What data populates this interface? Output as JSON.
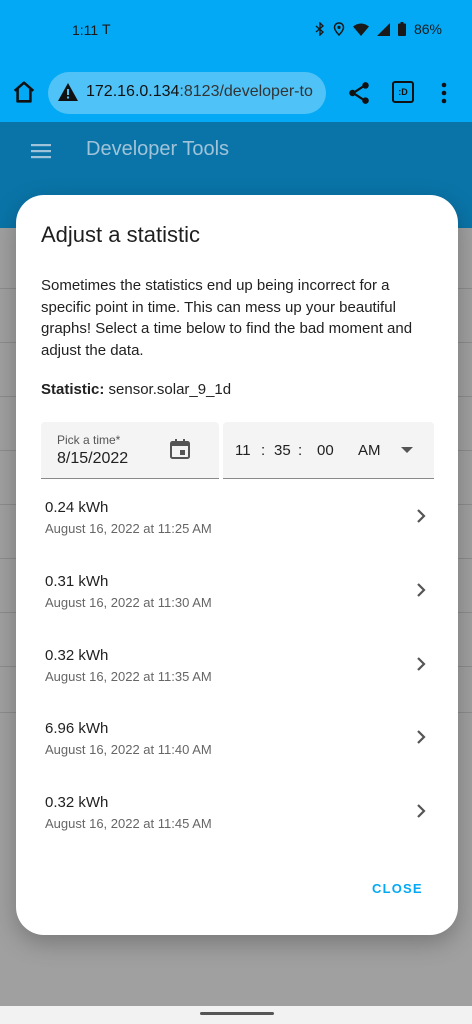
{
  "status_bar": {
    "time": "1:11",
    "carrier_glyph": "T",
    "battery": "86%"
  },
  "browser": {
    "url_host": "172.16.0.134",
    "url_rest": ":8123/developer-to",
    "tabs_label": ":D"
  },
  "app_header": {
    "title": "Developer Tools"
  },
  "dialog": {
    "title": "Adjust a statistic",
    "description": "Sometimes the statistics end up being incorrect for a specific point in time. This can mess up your beautiful graphs! Select a time below to find the bad moment and adjust the data.",
    "statistic_label": "Statistic:",
    "statistic_value": "sensor.solar_9_1d",
    "date_picker": {
      "label": "Pick a time*",
      "value": "8/15/2022"
    },
    "time_picker": {
      "hour": "11",
      "minute": "35",
      "second": "00",
      "sep1": ":",
      "sep2": ":",
      "ampm": "AM"
    },
    "entries": [
      {
        "value": "0.24 kWh",
        "timestamp": "August 16, 2022 at 11:25 AM"
      },
      {
        "value": "0.31 kWh",
        "timestamp": "August 16, 2022 at 11:30 AM"
      },
      {
        "value": "0.32 kWh",
        "timestamp": "August 16, 2022 at 11:35 AM"
      },
      {
        "value": "6.96 kWh",
        "timestamp": "August 16, 2022 at 11:40 AM"
      },
      {
        "value": "0.32 kWh",
        "timestamp": "August 16, 2022 at 11:45 AM"
      }
    ],
    "close_label": "CLOSE"
  },
  "colors": {
    "accent": "#03a9f4",
    "app_header": "#0a74a8"
  }
}
